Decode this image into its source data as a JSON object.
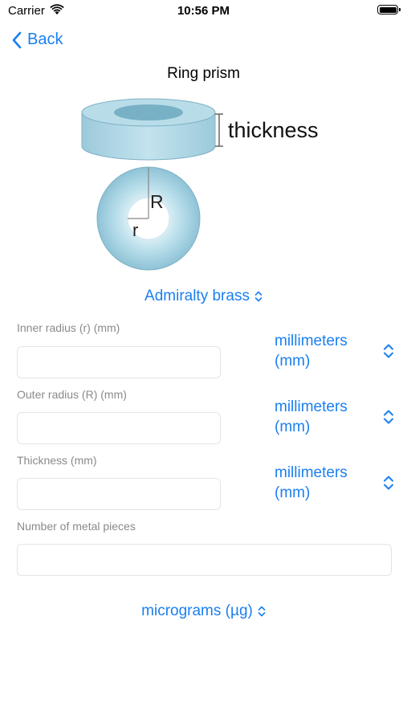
{
  "status_bar": {
    "carrier": "Carrier",
    "time": "10:56 PM"
  },
  "nav": {
    "back_label": "Back"
  },
  "page": {
    "title": "Ring prism"
  },
  "diagram": {
    "thickness_label": "thickness",
    "outer_radius_label": "R",
    "inner_radius_label": "r"
  },
  "material": {
    "value": "Admiralty brass"
  },
  "fields": [
    {
      "label": "Inner radius  (r) (mm)",
      "value": "",
      "unit": "millimeters (mm)"
    },
    {
      "label": "Outer radius (R) (mm)",
      "value": "",
      "unit": "millimeters (mm)"
    },
    {
      "label": "Thickness (mm)",
      "value": "",
      "unit": "millimeters (mm)"
    },
    {
      "label": "Number of metal pieces",
      "value": ""
    }
  ],
  "result_unit": {
    "value": "micrograms (µg)"
  },
  "colors": {
    "accent": "#1a7ff0",
    "label_gray": "#8a8a8e",
    "ring_fill": "#a9d3e3"
  }
}
